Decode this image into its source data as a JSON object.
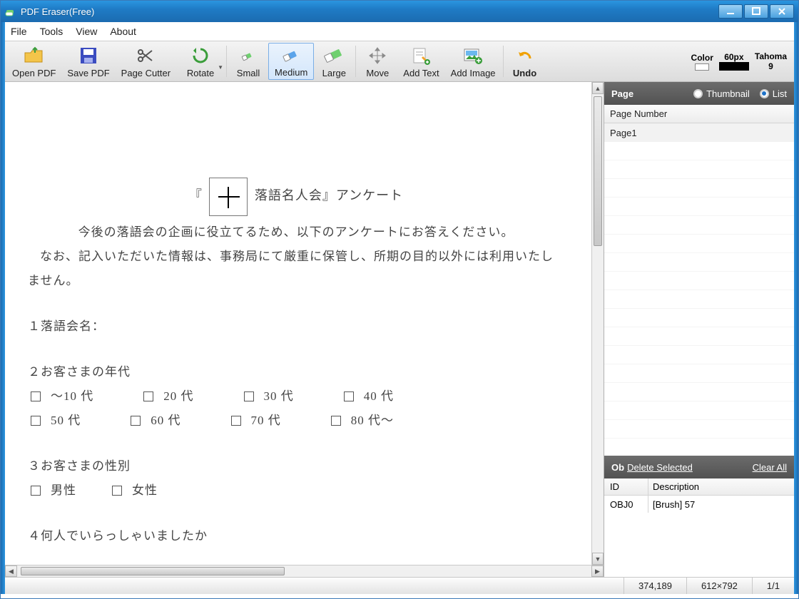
{
  "title": "PDF Eraser(Free)",
  "menubar": [
    "File",
    "Tools",
    "View",
    "About"
  ],
  "toolbar": {
    "open": "Open PDF",
    "save": "Save PDF",
    "cutter": "Page Cutter",
    "rotate": "Rotate",
    "small": "Small",
    "medium": "Medium",
    "large": "Large",
    "move": "Move",
    "addtext": "Add Text",
    "addimage": "Add Image",
    "undo": "Undo",
    "color_lbl": "Color",
    "size_lbl": "60px",
    "font_lbl": "Tahoma",
    "font_size": "9"
  },
  "doc": {
    "title_pre": "『",
    "title_post": "落語名人会』アンケート",
    "p1": "今後の落語会の企画に役立てるため、以下のアンケートにお答えください。",
    "p2": "なお、記入いただいた情報は、事務局にて厳重に保管し、所期の目的以外には利用いたしません。",
    "q1": "１落語会名：",
    "q2": "２お客さまの年代",
    "opts1": [
      "～10 代",
      "20 代",
      "30 代",
      "40 代"
    ],
    "opts2": [
      "50 代",
      "60 代",
      "70 代",
      "80 代～"
    ],
    "q3": "３お客さまの性別",
    "opts3": [
      "男性",
      "女性"
    ],
    "q4": "４何人でいらっしゃいましたか"
  },
  "side": {
    "page_title": "Page",
    "thumb": "Thumbnail",
    "list": "List",
    "col": "Page Number",
    "rows": [
      "Page1"
    ],
    "ob": "Ob",
    "del": "Delete Selected",
    "clear": "Clear All",
    "obj_hdr_id": "ID",
    "obj_hdr_desc": "Description",
    "obj_rows": [
      {
        "id": "OBJ0",
        "desc": "[Brush] 57"
      }
    ]
  },
  "status": {
    "coord": "374,189",
    "dim": "612×792",
    "pages": "1/1"
  }
}
